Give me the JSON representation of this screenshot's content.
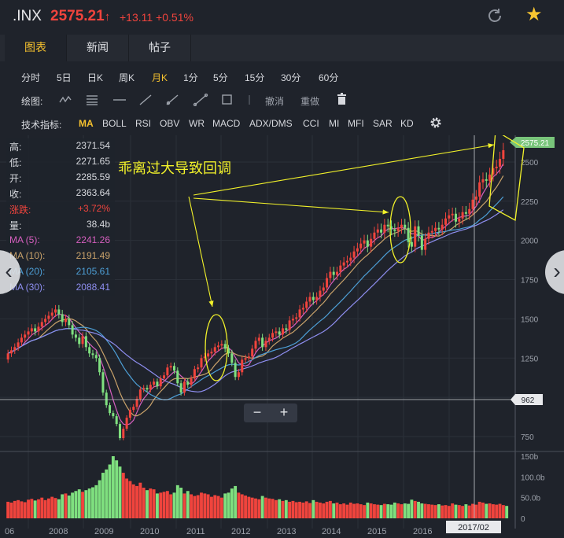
{
  "header": {
    "symbol": ".INX",
    "price": "2575.21",
    "arrow": "↑",
    "change": "+13.11 +0.51%",
    "refresh_icon": "refresh-icon",
    "star_icon": "star-icon"
  },
  "tabs": [
    {
      "label": "图表",
      "active": true
    },
    {
      "label": "新闻",
      "active": false
    },
    {
      "label": "帖子",
      "active": false
    }
  ],
  "periods": [
    {
      "label": "分时"
    },
    {
      "label": "5日"
    },
    {
      "label": "日K"
    },
    {
      "label": "周K"
    },
    {
      "label": "月K",
      "active": true
    },
    {
      "label": "1分"
    },
    {
      "label": "5分"
    },
    {
      "label": "15分"
    },
    {
      "label": "30分"
    },
    {
      "label": "60分"
    }
  ],
  "drawing": {
    "label": "绘图:",
    "undo": "撤消",
    "redo": "重做"
  },
  "indicators": {
    "label": "技术指标:",
    "items": [
      {
        "label": "MA",
        "active": true
      },
      {
        "label": "BOLL"
      },
      {
        "label": "RSI"
      },
      {
        "label": "OBV"
      },
      {
        "label": "WR"
      },
      {
        "label": "MACD"
      },
      {
        "label": "ADX/DMS"
      },
      {
        "label": "CCI"
      },
      {
        "label": "MI"
      },
      {
        "label": "MFI"
      },
      {
        "label": "SAR"
      },
      {
        "label": "KD"
      }
    ]
  },
  "info_panel": [
    {
      "key": "高:",
      "value": "2371.54"
    },
    {
      "key": "低:",
      "value": "2271.65"
    },
    {
      "key": "开:",
      "value": "2285.59"
    },
    {
      "key": "收:",
      "value": "2363.64"
    },
    {
      "key": "涨跌:",
      "value": "+3.72%",
      "color": "#f0443d"
    },
    {
      "key": "量:",
      "value": "38.4b"
    },
    {
      "key": "MA (5):",
      "value": "2241.26",
      "color": "#d65fbf"
    },
    {
      "key": "MA (10):",
      "value": "2191.49",
      "color": "#c9a26a"
    },
    {
      "key": "MA (20):",
      "value": "2105.61",
      "color": "#4d9fd6"
    },
    {
      "key": "MA (30):",
      "value": "2088.41",
      "color": "#8e8ef0"
    }
  ],
  "zoom": {
    "minus": "−",
    "plus": "+"
  },
  "colors": {
    "up": "#f0443d",
    "down": "#7fe07f",
    "accent": "#f5c12e",
    "annotation": "#f2f22a"
  },
  "chart_data": {
    "type": "candlestick",
    "annotation": "乖离过大导致回调",
    "y_ticks": [
      "2500",
      "2250",
      "2000",
      "1750",
      "1500",
      "1250",
      "1000",
      "750"
    ],
    "vol_ticks": [
      "150b",
      "100.0b",
      "50.0b",
      "0"
    ],
    "x_ticks": [
      "06",
      "2008",
      "2009",
      "2010",
      "2011",
      "2012",
      "2013",
      "2014",
      "2015",
      "2016"
    ],
    "crosshair_x_label": "2017/02",
    "crosshair_y_label": "962",
    "last_price_label": "2575.21",
    "ylim": [
      690,
      2620
    ],
    "closes": [
      1280,
      1300,
      1320,
      1350,
      1380,
      1400,
      1420,
      1440,
      1420,
      1450,
      1480,
      1500,
      1520,
      1540,
      1560,
      1530,
      1480,
      1500,
      1460,
      1400,
      1380,
      1340,
      1390,
      1320,
      1280,
      1270,
      1250,
      1160,
      1030,
      950,
      900,
      880,
      830,
      740,
      800,
      870,
      920,
      940,
      990,
      1050,
      1060,
      1050,
      1080,
      1100,
      1070,
      1120,
      1140,
      1190,
      1200,
      1170,
      1090,
      1030,
      1100,
      1080,
      1120,
      1180,
      1190,
      1250,
      1260,
      1280,
      1290,
      1320,
      1330,
      1340,
      1310,
      1280,
      1220,
      1130,
      1160,
      1240,
      1250,
      1260,
      1310,
      1360,
      1380,
      1320,
      1360,
      1380,
      1410,
      1420,
      1400,
      1440,
      1430,
      1490,
      1500,
      1510,
      1560,
      1570,
      1610,
      1640,
      1620,
      1640,
      1680,
      1700,
      1760,
      1800,
      1780,
      1800,
      1840,
      1860,
      1870,
      1890,
      1930,
      1950,
      1980,
      2000,
      1960,
      2010,
      2050,
      2070,
      2050,
      2100,
      2090,
      2070,
      2060,
      2080,
      2100,
      2080,
      1990,
      1960,
      2090,
      2030,
      1940,
      2010,
      2050,
      2060,
      2080,
      2070,
      2100,
      2140,
      2160,
      2170,
      2120,
      2140,
      2180,
      2170,
      2200,
      2260,
      2280,
      2370,
      2390,
      2380,
      2420,
      2460,
      2470,
      2520,
      2575
    ],
    "volumes": [
      40,
      38,
      42,
      44,
      41,
      39,
      45,
      47,
      43,
      46,
      50,
      44,
      48,
      52,
      49,
      46,
      58,
      60,
      55,
      62,
      66,
      70,
      64,
      68,
      72,
      75,
      80,
      92,
      110,
      118,
      130,
      150,
      140,
      125,
      110,
      96,
      90,
      82,
      78,
      86,
      74,
      68,
      72,
      70,
      60,
      62,
      64,
      66,
      58,
      62,
      80,
      74,
      60,
      66,
      58,
      54,
      56,
      62,
      60,
      58,
      52,
      56,
      54,
      50,
      60,
      62,
      72,
      78,
      62,
      58,
      55,
      52,
      50,
      48,
      46,
      54,
      50,
      48,
      47,
      44,
      46,
      42,
      44,
      40,
      42,
      39,
      40,
      38,
      41,
      37,
      44,
      40,
      38,
      36,
      40,
      42,
      36,
      38,
      34,
      36,
      33,
      38,
      35,
      36,
      34,
      32,
      38,
      36,
      34,
      33,
      32,
      35,
      34,
      33,
      38,
      36,
      34,
      36,
      35,
      45,
      42,
      40,
      36,
      35,
      34,
      33,
      32,
      34,
      31,
      32,
      30,
      36,
      33,
      32,
      30,
      34,
      31,
      35,
      33,
      40,
      38,
      35,
      36,
      34,
      33,
      35,
      32,
      30
    ]
  }
}
